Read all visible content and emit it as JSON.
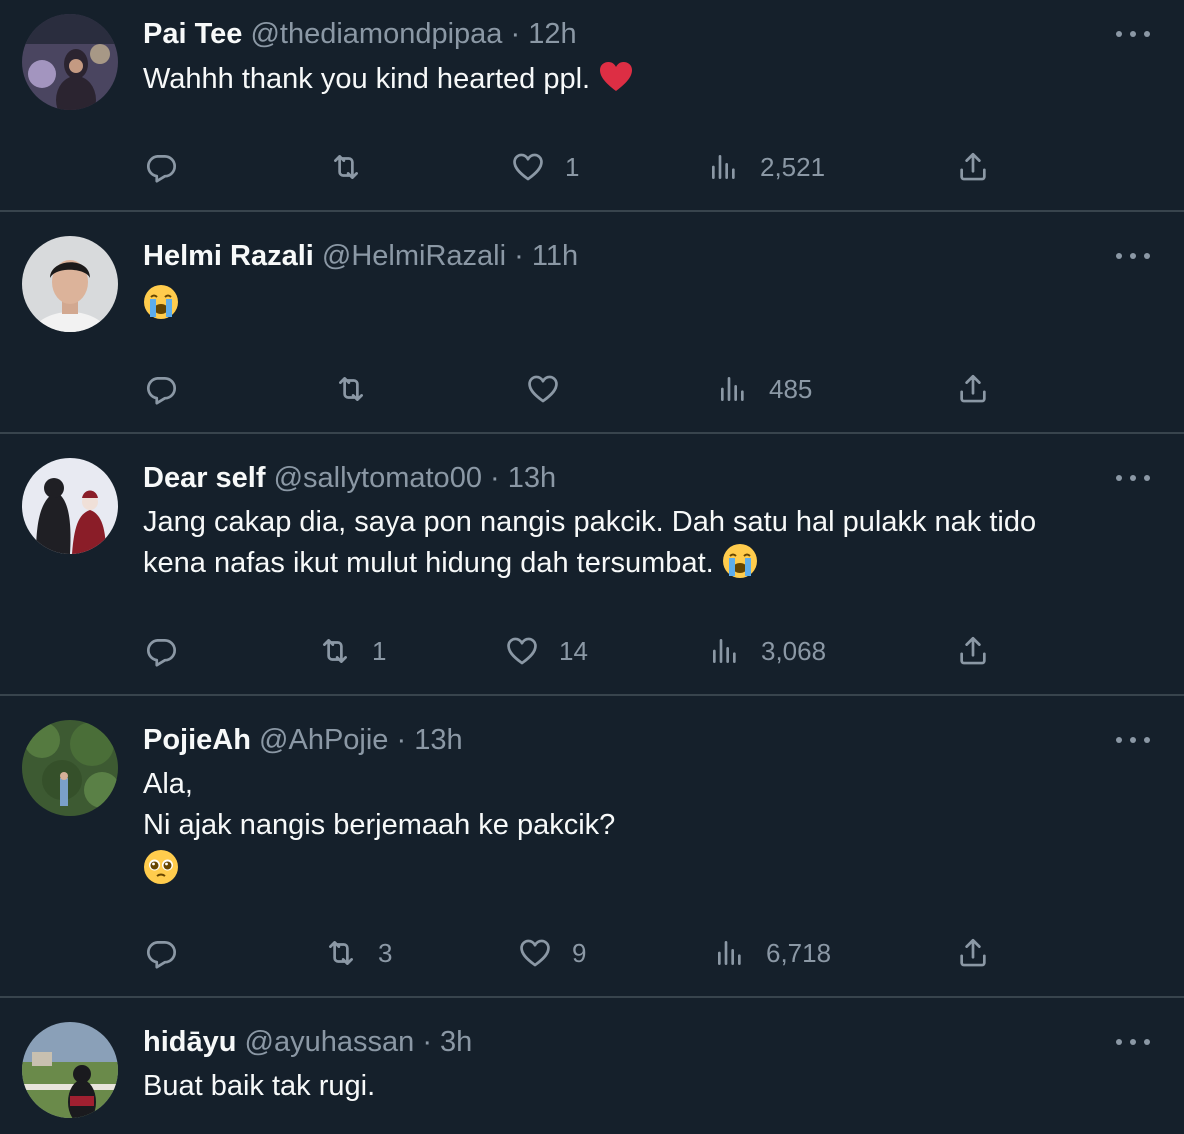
{
  "colors": {
    "background": "#15202b",
    "text": "#f7f9f9",
    "secondary": "#8b98a5",
    "divider": "#38444d",
    "heart": "#f91880"
  },
  "tweets": [
    {
      "name": "Pai Tee",
      "handle": "@thediamondpipaa",
      "time": "12h",
      "lines": [
        "Wahhh thank you kind hearted ppl."
      ],
      "emoji": [
        "red-heart"
      ],
      "replies": "",
      "retweets": "",
      "likes": "1",
      "views": "2,521"
    },
    {
      "name": "Helmi Razali",
      "handle": "@HelmiRazali",
      "time": "11h",
      "lines": [],
      "emoji": [
        "loudly-crying-face"
      ],
      "replies": "",
      "retweets": "",
      "likes": "",
      "views": "485"
    },
    {
      "name": "Dear self",
      "handle": "@sallytomato00",
      "time": "13h",
      "lines": [
        "Jang cakap dia, saya pon nangis pakcik. Dah satu hal pulakk nak tido",
        "kena nafas ikut mulut hidung dah tersumbat."
      ],
      "emoji": [
        "loudly-crying-face"
      ],
      "replies": "",
      "retweets": "1",
      "likes": "14",
      "views": "3,068"
    },
    {
      "name": "PojieAh",
      "handle": "@AhPojie",
      "time": "13h",
      "lines": [
        "Ala,",
        "Ni ajak nangis berjemaah ke pakcik?"
      ],
      "emoji": [
        "pleading-face"
      ],
      "replies": "",
      "retweets": "3",
      "likes": "9",
      "views": "6,718"
    },
    {
      "name": "hidāyu",
      "handle": "@ayuhassan",
      "time": "3h",
      "lines": [
        "Buat baik tak rugi."
      ],
      "emoji": [],
      "replies": "",
      "retweets": "",
      "likes": "",
      "views": ""
    }
  ]
}
